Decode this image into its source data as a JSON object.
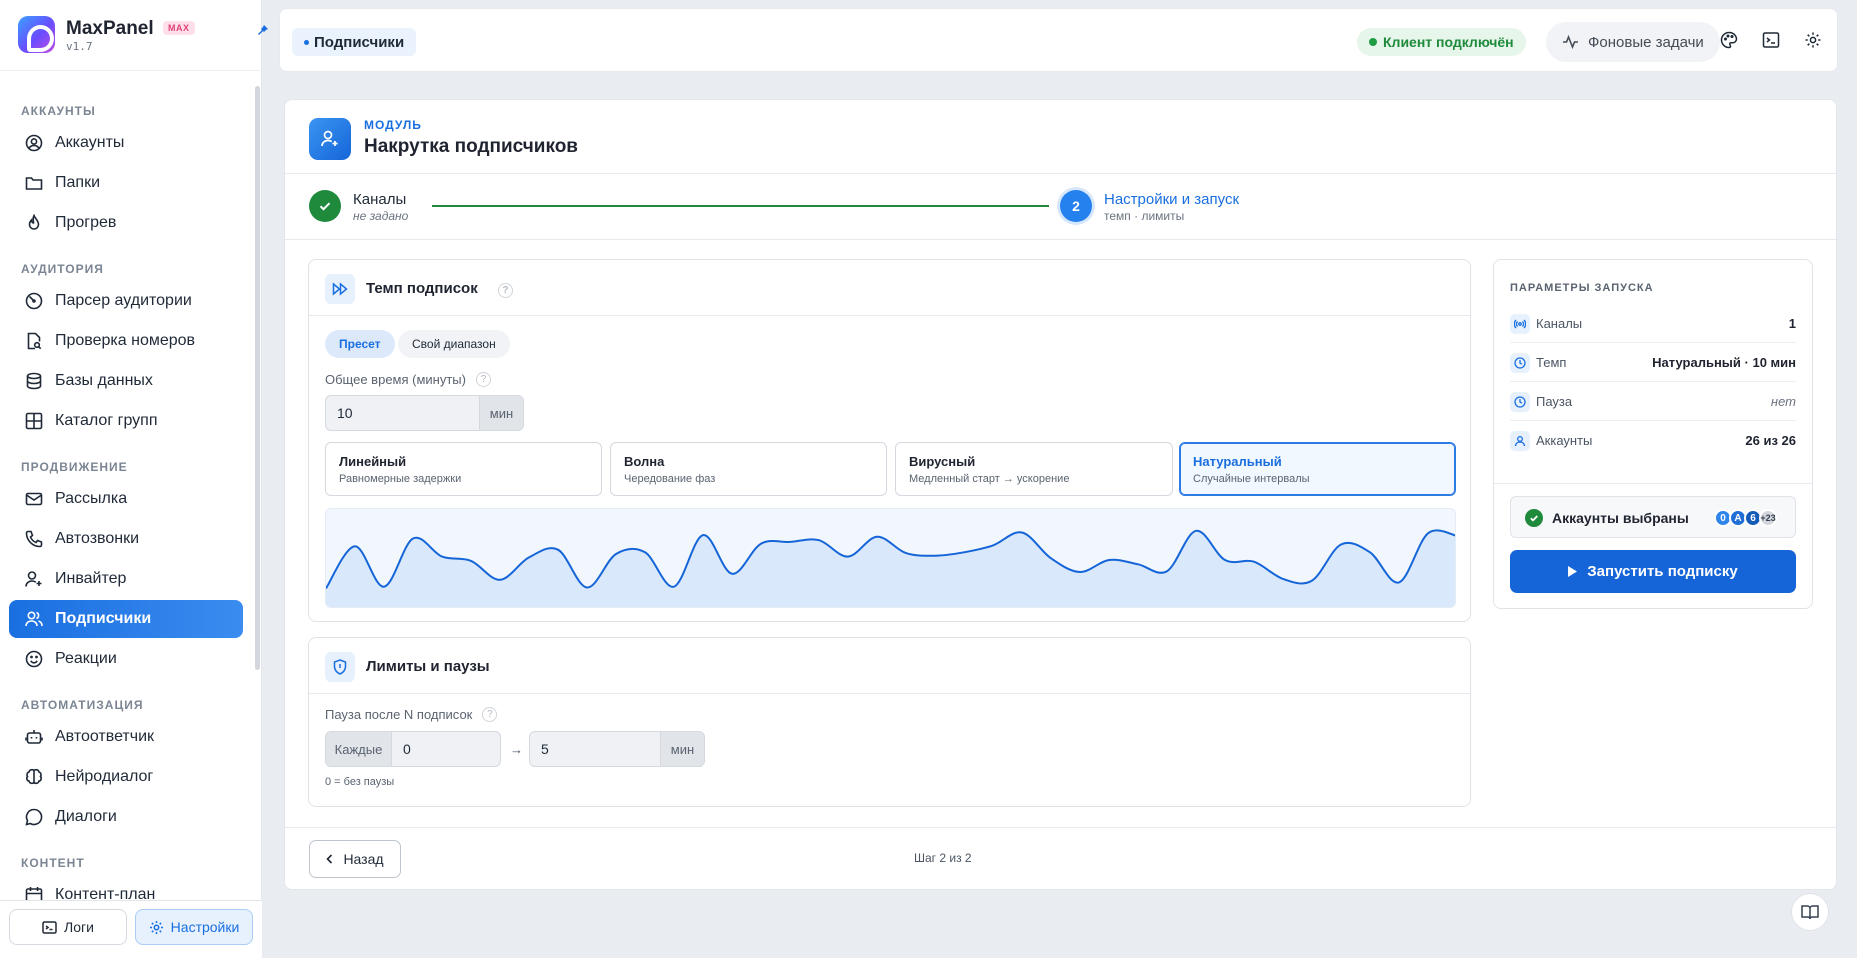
{
  "app": {
    "name": "MaxPanel",
    "badge": "MAX",
    "version": "v1.7"
  },
  "sidebar": {
    "sections": [
      {
        "title": "АККАУНТЫ"
      },
      {
        "title": "АУДИТОРИЯ"
      },
      {
        "title": "ПРОДВИЖЕНИЕ"
      },
      {
        "title": "АВТОМАТИЗАЦИЯ"
      },
      {
        "title": "КОНТЕНТ"
      }
    ],
    "items": [
      {
        "label": "Аккаунты",
        "icon": "user-circle-icon"
      },
      {
        "label": "Папки",
        "icon": "folder-icon"
      },
      {
        "label": "Прогрев",
        "icon": "flame-icon"
      },
      {
        "label": "Парсер аудитории",
        "icon": "radar-icon"
      },
      {
        "label": "Проверка номеров",
        "icon": "file-search-icon"
      },
      {
        "label": "Базы данных",
        "icon": "database-icon"
      },
      {
        "label": "Каталог групп",
        "icon": "grid-icon"
      },
      {
        "label": "Рассылка",
        "icon": "mail-icon"
      },
      {
        "label": "Автозвонки",
        "icon": "phone-icon"
      },
      {
        "label": "Инвайтер",
        "icon": "user-plus-icon"
      },
      {
        "label": "Подписчики",
        "icon": "users-icon"
      },
      {
        "label": "Реакции",
        "icon": "smile-icon"
      },
      {
        "label": "Автоответчик",
        "icon": "bot-icon"
      },
      {
        "label": "Нейродиалог",
        "icon": "brain-icon"
      },
      {
        "label": "Диалоги",
        "icon": "chat-icon"
      },
      {
        "label": "Контент-план",
        "icon": "calendar-icon"
      }
    ],
    "logs_label": "Логи",
    "settings_label": "Настройки"
  },
  "topbar": {
    "breadcrumb": "Подписчики",
    "status": "Клиент подключён",
    "tasks": "Фоновые задачи"
  },
  "module": {
    "kicker": "МОДУЛЬ",
    "title": "Накрутка подписчиков"
  },
  "steps": [
    {
      "title": "Каналы",
      "sub": "не задано"
    },
    {
      "num": "2",
      "title": "Настройки и запуск",
      "sub": "темп · лимиты"
    }
  ],
  "tempo": {
    "title": "Темп подписок",
    "help": "?",
    "mode_preset": "Пресет",
    "mode_custom": "Свой диапазон",
    "total_label": "Общее время (минуты)",
    "total_value": "10",
    "total_unit": "мин",
    "presets": [
      {
        "name": "Линейный",
        "desc": "Равномерные задержки"
      },
      {
        "name": "Волна",
        "desc": "Чередование фаз"
      },
      {
        "name": "Вирусный",
        "desc": "Медленный старт → ускорение"
      },
      {
        "name": "Натуральный",
        "desc": "Случайные интервалы"
      }
    ],
    "selected_preset": "Натуральный"
  },
  "limits": {
    "title": "Лимиты и паузы",
    "pause_label": "Пауза после N подписок",
    "every_label": "Каждые",
    "every_value": "0",
    "arrow": "→",
    "pause_value": "5",
    "pause_unit": "мин",
    "hint": "0 = без паузы"
  },
  "params": {
    "title": "ПАРАМЕТРЫ ЗАПУСКА",
    "rows": [
      {
        "key": "Каналы",
        "value": "1",
        "icon": "antenna-icon"
      },
      {
        "key": "Темп",
        "value": "Натуральный · 10 мин",
        "icon": "clock-icon"
      },
      {
        "key": "Пауза",
        "value": "нет",
        "icon": "clock-icon"
      },
      {
        "key": "Аккаунты",
        "value": "26 из 26",
        "icon": "user-icon"
      }
    ],
    "accounts_label": "Аккаунты выбраны",
    "avatars": [
      "0",
      "A",
      "6",
      "+23"
    ],
    "launch_label": "Запустить подписку"
  },
  "footer": {
    "back_label": "Назад",
    "step_count": "Шаг 2 из 2"
  },
  "colors": {
    "accent": "#1565d8",
    "success": "#1f8a3c"
  },
  "chart_data": {
    "type": "area",
    "title": "",
    "xlabel": "",
    "ylabel": "",
    "ylim": [
      0,
      1
    ],
    "values": [
      0.17,
      0.66,
      0.19,
      0.75,
      0.54,
      0.49,
      0.27,
      0.53,
      0.62,
      0.18,
      0.57,
      0.59,
      0.19,
      0.79,
      0.34,
      0.69,
      0.71,
      0.73,
      0.54,
      0.77,
      0.58,
      0.55,
      0.59,
      0.67,
      0.82,
      0.52,
      0.36,
      0.5,
      0.45,
      0.37,
      0.84,
      0.5,
      0.48,
      0.28,
      0.26,
      0.68,
      0.59,
      0.24,
      0.81,
      0.78
    ]
  }
}
